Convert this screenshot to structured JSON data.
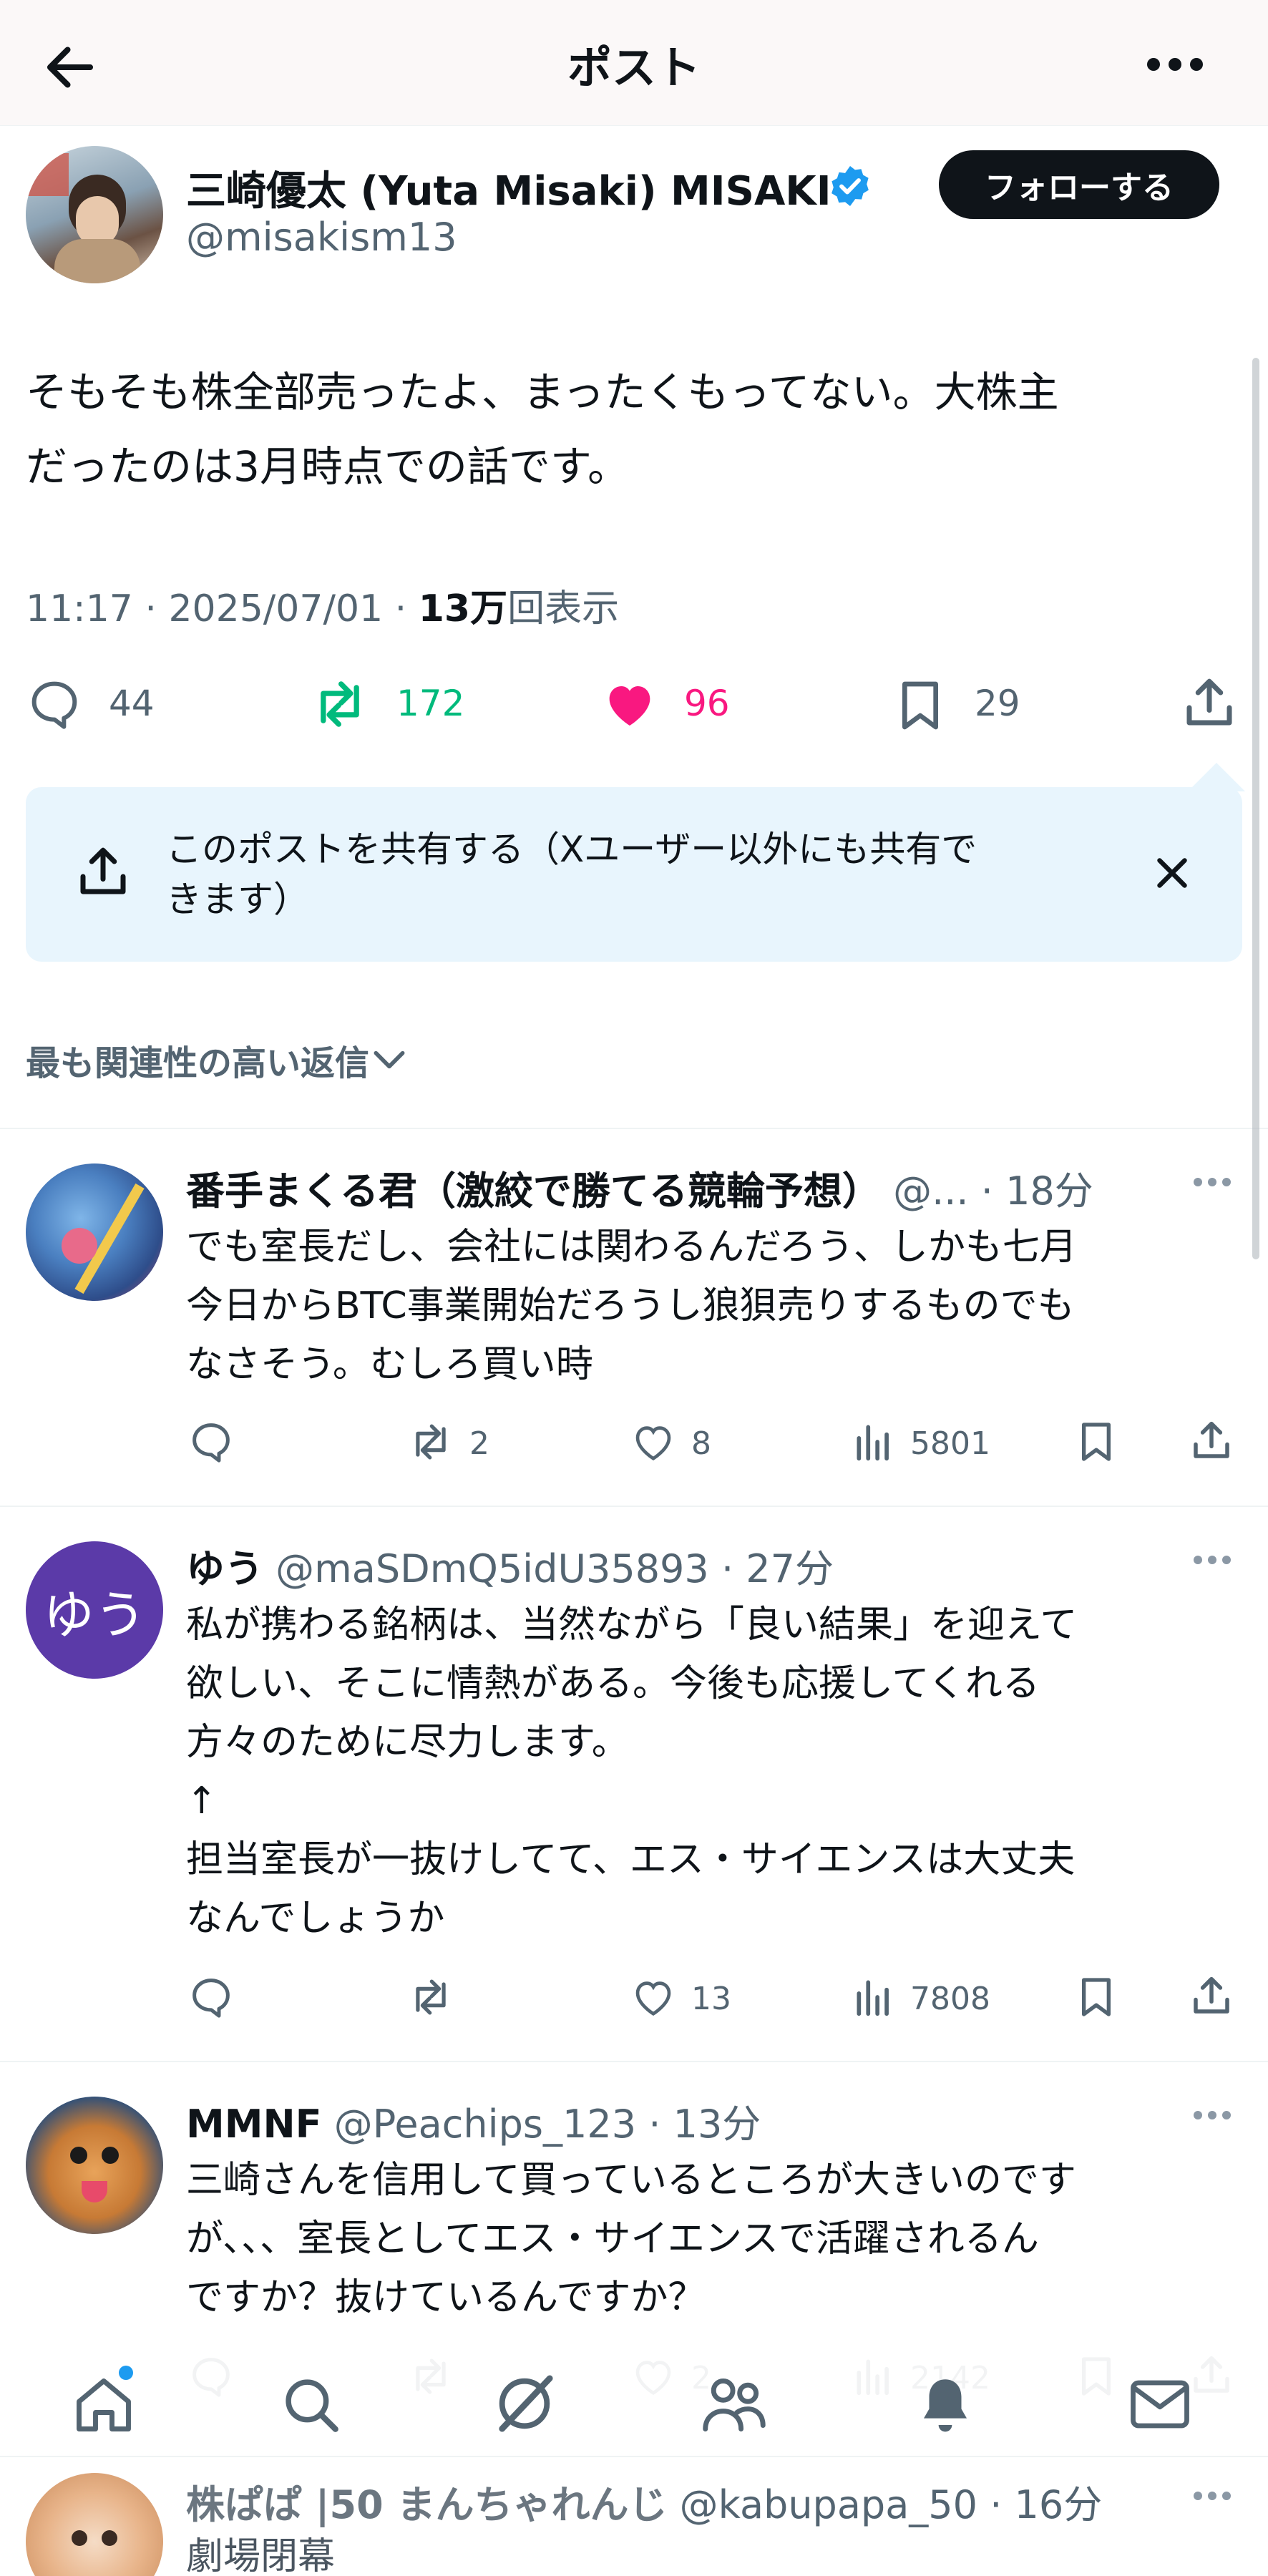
{
  "header": {
    "title": "ポスト"
  },
  "post": {
    "author_name": "三崎優太 (Yuta Misaki) MISAKI",
    "author_handle": "@misakism13",
    "follow_label": "フォローする",
    "text_line1": "そもそも株全部売ったよ、まったくもってない。大株主",
    "text_line2": "だったのは3月時点での話です。",
    "time_date": "11:17 · 2025/07/01 ·",
    "views_count": "13万",
    "views_label": "回表示",
    "replies": "44",
    "reposts": "172",
    "likes": "96",
    "bookmarks": "29"
  },
  "share_prompt": {
    "line1": "このポストを共有する（Xユーザー以外にも共有で",
    "line2": "きます）"
  },
  "sort": {
    "label": "最も関連性の高い返信"
  },
  "replies": [
    {
      "name": "番手まくる君（激絞で勝てる競輪予想）",
      "handle": "@...",
      "time": "· 18分",
      "lines": [
        "でも室長だし、会社には関わるんだろう、しかも七月",
        "今日からBTC事業開始だろうし狼狽売りするものでも",
        "なさそう。むしろ買い時"
      ],
      "reposts": "2",
      "likes": "8",
      "views": "5801"
    },
    {
      "name": "ゆう",
      "handle": "@maSDmQ5idU35893",
      "time": "· 27分",
      "avatar_text": "ゆう",
      "lines": [
        "私が携わる銘柄は、当然ながら「良い結果」を迎えて",
        "欲しい、そこに情熱がある。今後も応援してくれる",
        "方々のために尽力します。",
        "↑",
        "担当室長が一抜けしてて、エス・サイエンスは大丈夫",
        "なんでしょうか"
      ],
      "reposts": "",
      "likes": "13",
      "views": "7808"
    },
    {
      "name": "MMNF",
      "handle": "@Peachips_123",
      "time": "· 13分",
      "lines": [
        "三崎さんを信用して買っているところが大きいのです",
        "が、、、室長としてエス・サイエンスで活躍されるん",
        "ですか？抜けているんですか？"
      ],
      "reposts": "",
      "likes": "2",
      "views": "2142"
    },
    {
      "name": "株ぱぱ |50 まんちゃれんじ",
      "handle": "@kabupapa_50",
      "time": "· 16分",
      "lines": [
        "劇場閉幕"
      ]
    }
  ],
  "colors": {
    "retweet": "#00ba7c",
    "like": "#f91880",
    "verified": "#1d9bf0",
    "share_bg": "#e8f5fd",
    "avatar_yuu": "#5b3aa8"
  }
}
